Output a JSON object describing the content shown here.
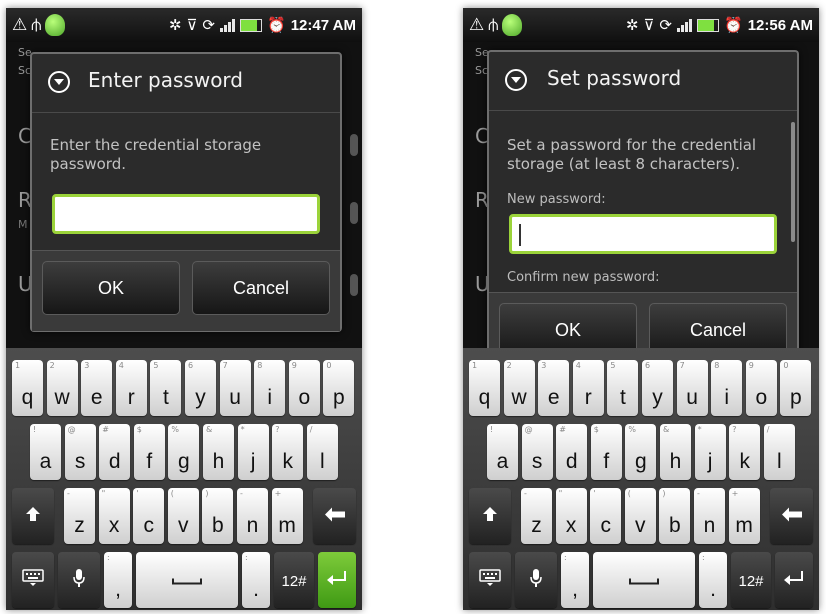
{
  "status_left": {
    "time": "12:47 AM"
  },
  "status_right": {
    "time": "12:56 AM"
  },
  "dialog_left": {
    "title": "Enter password",
    "body": "Enter the credential storage password.",
    "ok": "OK",
    "cancel": "Cancel"
  },
  "dialog_right": {
    "title": "Set password",
    "body": "Set a password for the credential storage (at least 8 characters).",
    "new_label": "New password:",
    "confirm_label": "Confirm new password:",
    "ok": "OK",
    "cancel": "Cancel"
  },
  "background_partial": [
    "Se",
    "Sc",
    "C",
    "R",
    "M",
    "U",
    "L"
  ],
  "keyboard": {
    "row1": [
      {
        "alt": "1",
        "key": "q"
      },
      {
        "alt": "2",
        "key": "w"
      },
      {
        "alt": "3",
        "key": "e"
      },
      {
        "alt": "4",
        "key": "r"
      },
      {
        "alt": "5",
        "key": "t"
      },
      {
        "alt": "6",
        "key": "y"
      },
      {
        "alt": "7",
        "key": "u"
      },
      {
        "alt": "8",
        "key": "i"
      },
      {
        "alt": "9",
        "key": "o"
      },
      {
        "alt": "0",
        "key": "p"
      }
    ],
    "row2": [
      {
        "alt": "!",
        "key": "a"
      },
      {
        "alt": "@",
        "key": "s"
      },
      {
        "alt": "#",
        "key": "d"
      },
      {
        "alt": "$",
        "key": "f"
      },
      {
        "alt": "%",
        "key": "g"
      },
      {
        "alt": "&",
        "key": "h"
      },
      {
        "alt": "*",
        "key": "j"
      },
      {
        "alt": "?",
        "key": "k"
      },
      {
        "alt": "/",
        "key": "l"
      }
    ],
    "row3": [
      {
        "alt": "-",
        "key": "z"
      },
      {
        "alt": "\"",
        "key": "x"
      },
      {
        "alt": "'",
        "key": "c"
      },
      {
        "alt": "(",
        "key": "v"
      },
      {
        "alt": ")",
        "key": "b"
      },
      {
        "alt": "-",
        "key": "n"
      },
      {
        "alt": "+",
        "key": "m"
      }
    ],
    "comma": ",",
    "period": ".",
    "symbols": "12#",
    "comma_alt": ":",
    "period_alt": ":"
  },
  "colors": {
    "accent_field": "#9bd33a",
    "enter_green": "#5aaf22"
  },
  "icons": [
    "alert-icon",
    "usb-icon",
    "android-icon",
    "bluetooth-icon",
    "wifi-icon",
    "sync-icon",
    "signal-icon",
    "battery-icon",
    "alarm-icon",
    "dialog-down-icon",
    "shift-icon",
    "backspace-icon",
    "keyboard-settings-icon",
    "mic-icon",
    "enter-icon"
  ]
}
